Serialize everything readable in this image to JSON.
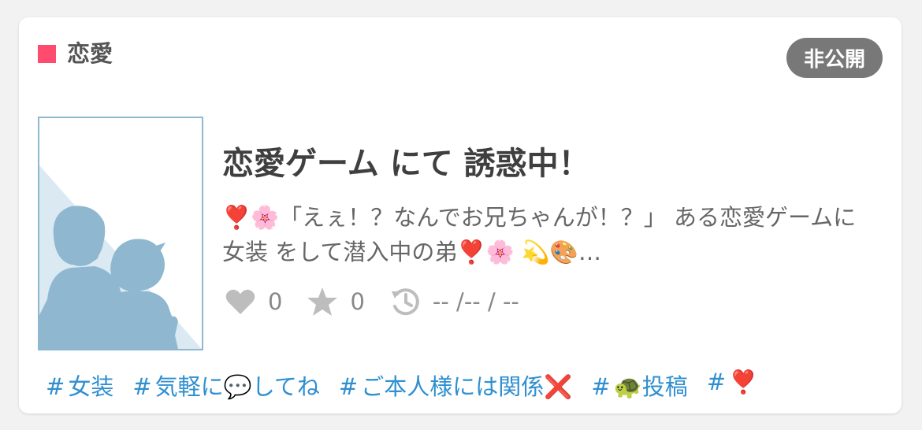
{
  "card": {
    "genre": {
      "label": "恋愛",
      "color": "#ff4b6e"
    },
    "visibility_badge": "非公開",
    "title": "恋愛ゲーム にて 誘惑中！",
    "description": "❣️🌸「えぇ！？なんでお兄ちゃんが！？」 ある恋愛ゲームに 女装 をして潜入中の弟❣️🌸 💫🎨…",
    "stats": {
      "likes": "0",
      "bookmarks": "0",
      "updated": "-- /-- / --"
    },
    "tags": [
      {
        "hash": "#",
        "label": "女装"
      },
      {
        "hash": "#",
        "label": "気軽に💬してね"
      },
      {
        "hash": "#",
        "label": "ご本人様には関係❌"
      },
      {
        "hash": "#",
        "label": "🐢投稿"
      },
      {
        "hash": "#",
        "label": "❣️"
      }
    ]
  },
  "icons": {
    "likes": "heart-icon",
    "bookmarks": "star-icon",
    "updated": "history-icon",
    "thumbnail": "silhouette-image"
  },
  "colors": {
    "accent": "#ff4b6e",
    "badge_bg": "#787878",
    "tag_link": "#2f8fd0",
    "thumbnail_silhouette": "#8fb8d0"
  }
}
